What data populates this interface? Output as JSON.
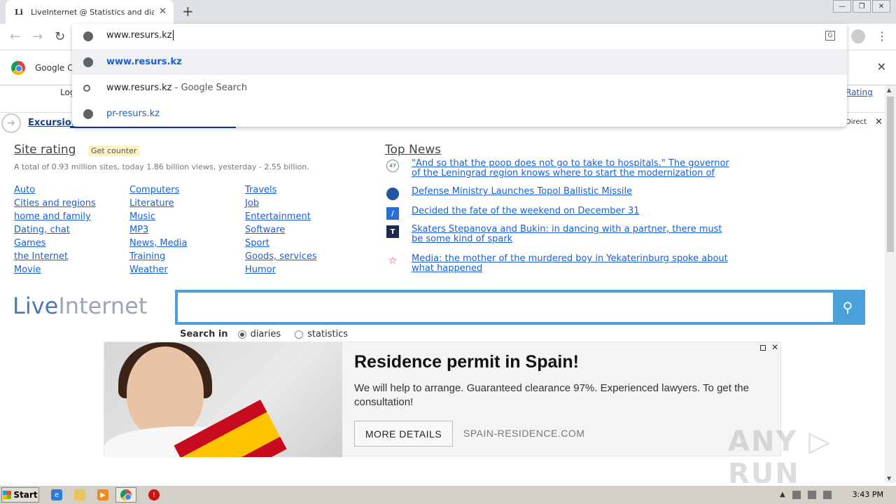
{
  "browser": {
    "tab_title": "LiveInternet @ Statistics and diaries",
    "tab_favicon": "Li",
    "omnibox": {
      "input": "www.resurs.kz",
      "suggestions": [
        {
          "icon": "globe-icon",
          "text": "www.resurs.kz",
          "sub": ""
        },
        {
          "icon": "search-icon",
          "text": "www.resurs.kz",
          "sub": " - Google Search"
        },
        {
          "icon": "globe-icon",
          "text": "pr-resurs.kz",
          "sub": ""
        }
      ]
    },
    "infobar_text": "Google Cl"
  },
  "page": {
    "topbar_left": "Log",
    "topbar_right": "Rating",
    "adbar": {
      "text": "Excursion",
      "direct": "Direct"
    },
    "site_rating": {
      "title": "Site rating",
      "badge": "Get counter",
      "desc": "A total of 0.93 million sites, today 1.86 billion views, yesterday - 2.55 billion."
    },
    "categories": {
      "col1": [
        "Auto",
        "Cities and regions",
        "home and family",
        "Dating, chat",
        "Games",
        "the Internet",
        "Movie"
      ],
      "col2": [
        "Computers",
        "Literature",
        "Music",
        "MP3",
        "News, Media",
        "Training",
        "Weather"
      ],
      "col3": [
        "Travels",
        "Job",
        "Entertainment",
        "Software",
        "Sport",
        "Goods, services",
        "Humor"
      ]
    },
    "top_news": {
      "title": "Top News",
      "items": [
        {
          "icon_text": "47",
          "text": "\"And so that the poop does not go to take to hospitals.\" The governor of the Leningrad region knows where to start the modernization of",
          "color": "#7a8b99"
        },
        {
          "icon_text": "",
          "text": "Defense Ministry Launches Topol Ballistic Missile",
          "color": "#2455a4"
        },
        {
          "icon_text": "/",
          "text": "Decided the fate of the weekend on December 31",
          "color": "#2b6fd6"
        },
        {
          "icon_text": "T",
          "text": "Skaters Stepanova and Bukin: in dancing with a partner, there must be some kind of spark",
          "color": "#1d2a4d"
        },
        {
          "icon_text": "☆",
          "text": "Media: the mother of the murdered boy in Yekaterinburg spoke about what happened",
          "color": "#e03030"
        }
      ]
    },
    "logo": {
      "live": "Live",
      "internet": "Internet"
    },
    "search": {
      "label": "Search in",
      "options": [
        "diaries",
        "statistics"
      ]
    },
    "ad": {
      "title": "Residence permit in Spain!",
      "desc": "We will help to arrange. Guaranteed clearance 97%. Experienced lawyers. To get the consultation!",
      "button": "MORE DETAILS",
      "domain": "SPAIN-RESIDENCE.COM"
    },
    "watermark": "ANY ▷ RUN"
  },
  "taskbar": {
    "start": "Start",
    "clock": "3:43 PM"
  }
}
